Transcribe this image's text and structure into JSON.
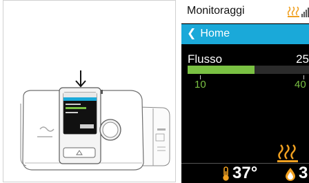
{
  "colors": {
    "accent_blue": "#1aa9d9",
    "bar_green": "#7ac143",
    "heat_orange": "#f0a020",
    "screen_bg": "#000000"
  },
  "status": {
    "title": "Monitoraggi",
    "icons": [
      "humidifier-status-icon",
      "signal-bars-icon"
    ]
  },
  "nav": {
    "back_label": "Home",
    "back_icon": "chevron-left-icon"
  },
  "flow": {
    "label": "Flusso",
    "value": "25",
    "bar_fraction": 0.55,
    "ticks": [
      "10",
      "40"
    ]
  },
  "footer": {
    "heat_icon": "heated-tube-icon",
    "temp_icon": "thermometer-icon",
    "temperature": "37°",
    "humidity_icon": "droplet-icon",
    "humidity": "3"
  },
  "device": {
    "arrow_icon": "down-arrow-icon",
    "logo_icon": "resmed-logo-icon"
  }
}
